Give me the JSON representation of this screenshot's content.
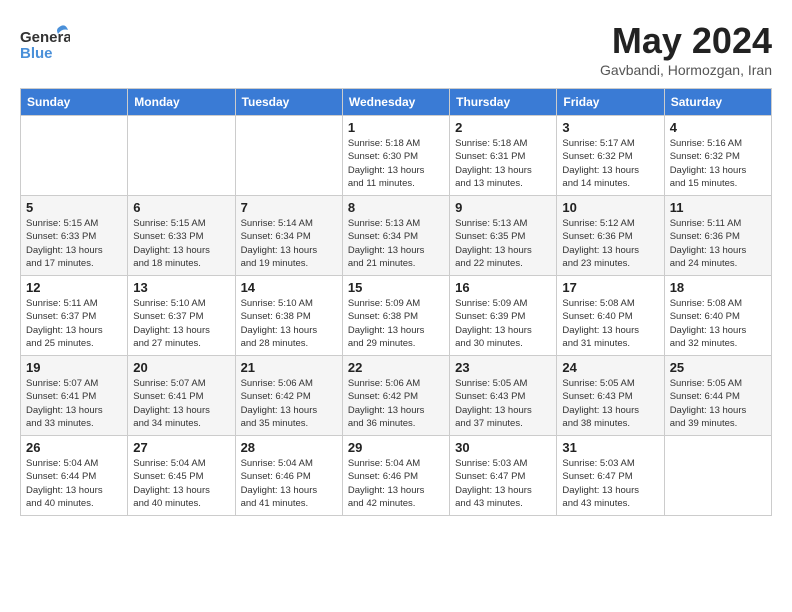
{
  "logo": {
    "line1": "General",
    "line2": "Blue"
  },
  "title": "May 2024",
  "location": "Gavbandi, Hormozgan, Iran",
  "weekdays": [
    "Sunday",
    "Monday",
    "Tuesday",
    "Wednesday",
    "Thursday",
    "Friday",
    "Saturday"
  ],
  "weeks": [
    [
      {
        "day": "",
        "info": ""
      },
      {
        "day": "",
        "info": ""
      },
      {
        "day": "",
        "info": ""
      },
      {
        "day": "1",
        "info": "Sunrise: 5:18 AM\nSunset: 6:30 PM\nDaylight: 13 hours\nand 11 minutes."
      },
      {
        "day": "2",
        "info": "Sunrise: 5:18 AM\nSunset: 6:31 PM\nDaylight: 13 hours\nand 13 minutes."
      },
      {
        "day": "3",
        "info": "Sunrise: 5:17 AM\nSunset: 6:32 PM\nDaylight: 13 hours\nand 14 minutes."
      },
      {
        "day": "4",
        "info": "Sunrise: 5:16 AM\nSunset: 6:32 PM\nDaylight: 13 hours\nand 15 minutes."
      }
    ],
    [
      {
        "day": "5",
        "info": "Sunrise: 5:15 AM\nSunset: 6:33 PM\nDaylight: 13 hours\nand 17 minutes."
      },
      {
        "day": "6",
        "info": "Sunrise: 5:15 AM\nSunset: 6:33 PM\nDaylight: 13 hours\nand 18 minutes."
      },
      {
        "day": "7",
        "info": "Sunrise: 5:14 AM\nSunset: 6:34 PM\nDaylight: 13 hours\nand 19 minutes."
      },
      {
        "day": "8",
        "info": "Sunrise: 5:13 AM\nSunset: 6:34 PM\nDaylight: 13 hours\nand 21 minutes."
      },
      {
        "day": "9",
        "info": "Sunrise: 5:13 AM\nSunset: 6:35 PM\nDaylight: 13 hours\nand 22 minutes."
      },
      {
        "day": "10",
        "info": "Sunrise: 5:12 AM\nSunset: 6:36 PM\nDaylight: 13 hours\nand 23 minutes."
      },
      {
        "day": "11",
        "info": "Sunrise: 5:11 AM\nSunset: 6:36 PM\nDaylight: 13 hours\nand 24 minutes."
      }
    ],
    [
      {
        "day": "12",
        "info": "Sunrise: 5:11 AM\nSunset: 6:37 PM\nDaylight: 13 hours\nand 25 minutes."
      },
      {
        "day": "13",
        "info": "Sunrise: 5:10 AM\nSunset: 6:37 PM\nDaylight: 13 hours\nand 27 minutes."
      },
      {
        "day": "14",
        "info": "Sunrise: 5:10 AM\nSunset: 6:38 PM\nDaylight: 13 hours\nand 28 minutes."
      },
      {
        "day": "15",
        "info": "Sunrise: 5:09 AM\nSunset: 6:38 PM\nDaylight: 13 hours\nand 29 minutes."
      },
      {
        "day": "16",
        "info": "Sunrise: 5:09 AM\nSunset: 6:39 PM\nDaylight: 13 hours\nand 30 minutes."
      },
      {
        "day": "17",
        "info": "Sunrise: 5:08 AM\nSunset: 6:40 PM\nDaylight: 13 hours\nand 31 minutes."
      },
      {
        "day": "18",
        "info": "Sunrise: 5:08 AM\nSunset: 6:40 PM\nDaylight: 13 hours\nand 32 minutes."
      }
    ],
    [
      {
        "day": "19",
        "info": "Sunrise: 5:07 AM\nSunset: 6:41 PM\nDaylight: 13 hours\nand 33 minutes."
      },
      {
        "day": "20",
        "info": "Sunrise: 5:07 AM\nSunset: 6:41 PM\nDaylight: 13 hours\nand 34 minutes."
      },
      {
        "day": "21",
        "info": "Sunrise: 5:06 AM\nSunset: 6:42 PM\nDaylight: 13 hours\nand 35 minutes."
      },
      {
        "day": "22",
        "info": "Sunrise: 5:06 AM\nSunset: 6:42 PM\nDaylight: 13 hours\nand 36 minutes."
      },
      {
        "day": "23",
        "info": "Sunrise: 5:05 AM\nSunset: 6:43 PM\nDaylight: 13 hours\nand 37 minutes."
      },
      {
        "day": "24",
        "info": "Sunrise: 5:05 AM\nSunset: 6:43 PM\nDaylight: 13 hours\nand 38 minutes."
      },
      {
        "day": "25",
        "info": "Sunrise: 5:05 AM\nSunset: 6:44 PM\nDaylight: 13 hours\nand 39 minutes."
      }
    ],
    [
      {
        "day": "26",
        "info": "Sunrise: 5:04 AM\nSunset: 6:44 PM\nDaylight: 13 hours\nand 40 minutes."
      },
      {
        "day": "27",
        "info": "Sunrise: 5:04 AM\nSunset: 6:45 PM\nDaylight: 13 hours\nand 40 minutes."
      },
      {
        "day": "28",
        "info": "Sunrise: 5:04 AM\nSunset: 6:46 PM\nDaylight: 13 hours\nand 41 minutes."
      },
      {
        "day": "29",
        "info": "Sunrise: 5:04 AM\nSunset: 6:46 PM\nDaylight: 13 hours\nand 42 minutes."
      },
      {
        "day": "30",
        "info": "Sunrise: 5:03 AM\nSunset: 6:47 PM\nDaylight: 13 hours\nand 43 minutes."
      },
      {
        "day": "31",
        "info": "Sunrise: 5:03 AM\nSunset: 6:47 PM\nDaylight: 13 hours\nand 43 minutes."
      },
      {
        "day": "",
        "info": ""
      }
    ]
  ]
}
